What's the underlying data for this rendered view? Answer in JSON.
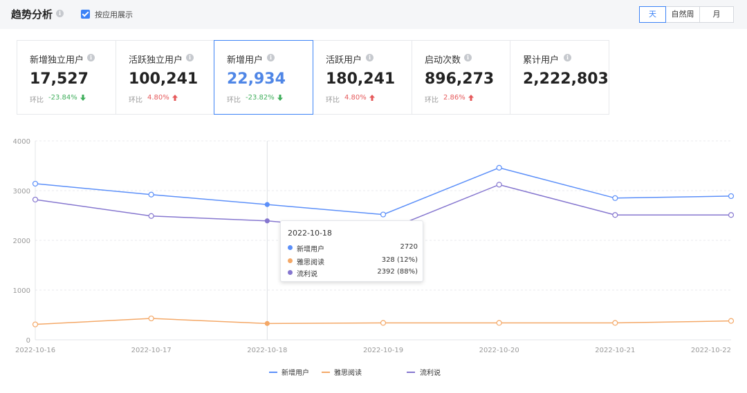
{
  "header": {
    "title": "趋势分析",
    "info_icon": "i",
    "checkbox_label": "按应用展示",
    "checkbox_checked": true,
    "periods": [
      {
        "label": "天",
        "active": true
      },
      {
        "label": "自然周",
        "active": false
      },
      {
        "label": "月",
        "active": false,
        "disabled": true
      }
    ]
  },
  "cards": [
    {
      "label": "新增独立用户",
      "value": "17,527",
      "cmp_label": "环比",
      "pct": "-23.84%",
      "trend": "down"
    },
    {
      "label": "活跃独立用户",
      "value": "100,241",
      "cmp_label": "环比",
      "pct": "4.80%",
      "trend": "up"
    },
    {
      "label": "新增用户",
      "value": "22,934",
      "cmp_label": "环比",
      "pct": "-23.82%",
      "trend": "down",
      "selected": true
    },
    {
      "label": "活跃用户",
      "value": "180,241",
      "cmp_label": "环比",
      "pct": "4.80%",
      "trend": "up"
    },
    {
      "label": "启动次数",
      "value": "896,273",
      "cmp_label": "环比",
      "pct": "2.86%",
      "trend": "up"
    },
    {
      "label": "累计用户",
      "value": "2,222,803"
    }
  ],
  "colors": {
    "accent": "#3b82f6",
    "series_new_users": "#5b8ff9",
    "series_yasi": "#f4a867",
    "series_liulishuo": "#8576cf",
    "down": "#3fae5b",
    "up": "#e5585a"
  },
  "chart_data": {
    "type": "line",
    "x": [
      "2022-10-16",
      "2022-10-17",
      "2022-10-18",
      "2022-10-19",
      "2022-10-20",
      "2022-10-21",
      "2022-10-22"
    ],
    "ylim": [
      0,
      4000
    ],
    "yticks": [
      0,
      1000,
      2000,
      3000,
      4000
    ],
    "grid": true,
    "legend": "bottom",
    "series": [
      {
        "name": "新增用户",
        "values": [
          3140,
          2920,
          2720,
          2520,
          3460,
          2850,
          2890
        ],
        "color": "#5b8ff9"
      },
      {
        "name": "雅思阅读",
        "values": [
          310,
          430,
          328,
          340,
          340,
          340,
          380
        ],
        "color": "#f4a867"
      },
      {
        "name": "流利说",
        "values": [
          2820,
          2490,
          2392,
          2180,
          3120,
          2510,
          2510
        ],
        "color": "#8576cf"
      }
    ],
    "highlight_index": 2
  },
  "tooltip": {
    "date": "2022-10-18",
    "rows": [
      {
        "name": "新增用户",
        "value": "2720",
        "color": "#5b8ff9"
      },
      {
        "name": "雅思阅读",
        "value": "328 (12%)",
        "color": "#f4a867"
      },
      {
        "name": "流利说",
        "value": "2392 (88%)",
        "color": "#8576cf"
      }
    ]
  }
}
